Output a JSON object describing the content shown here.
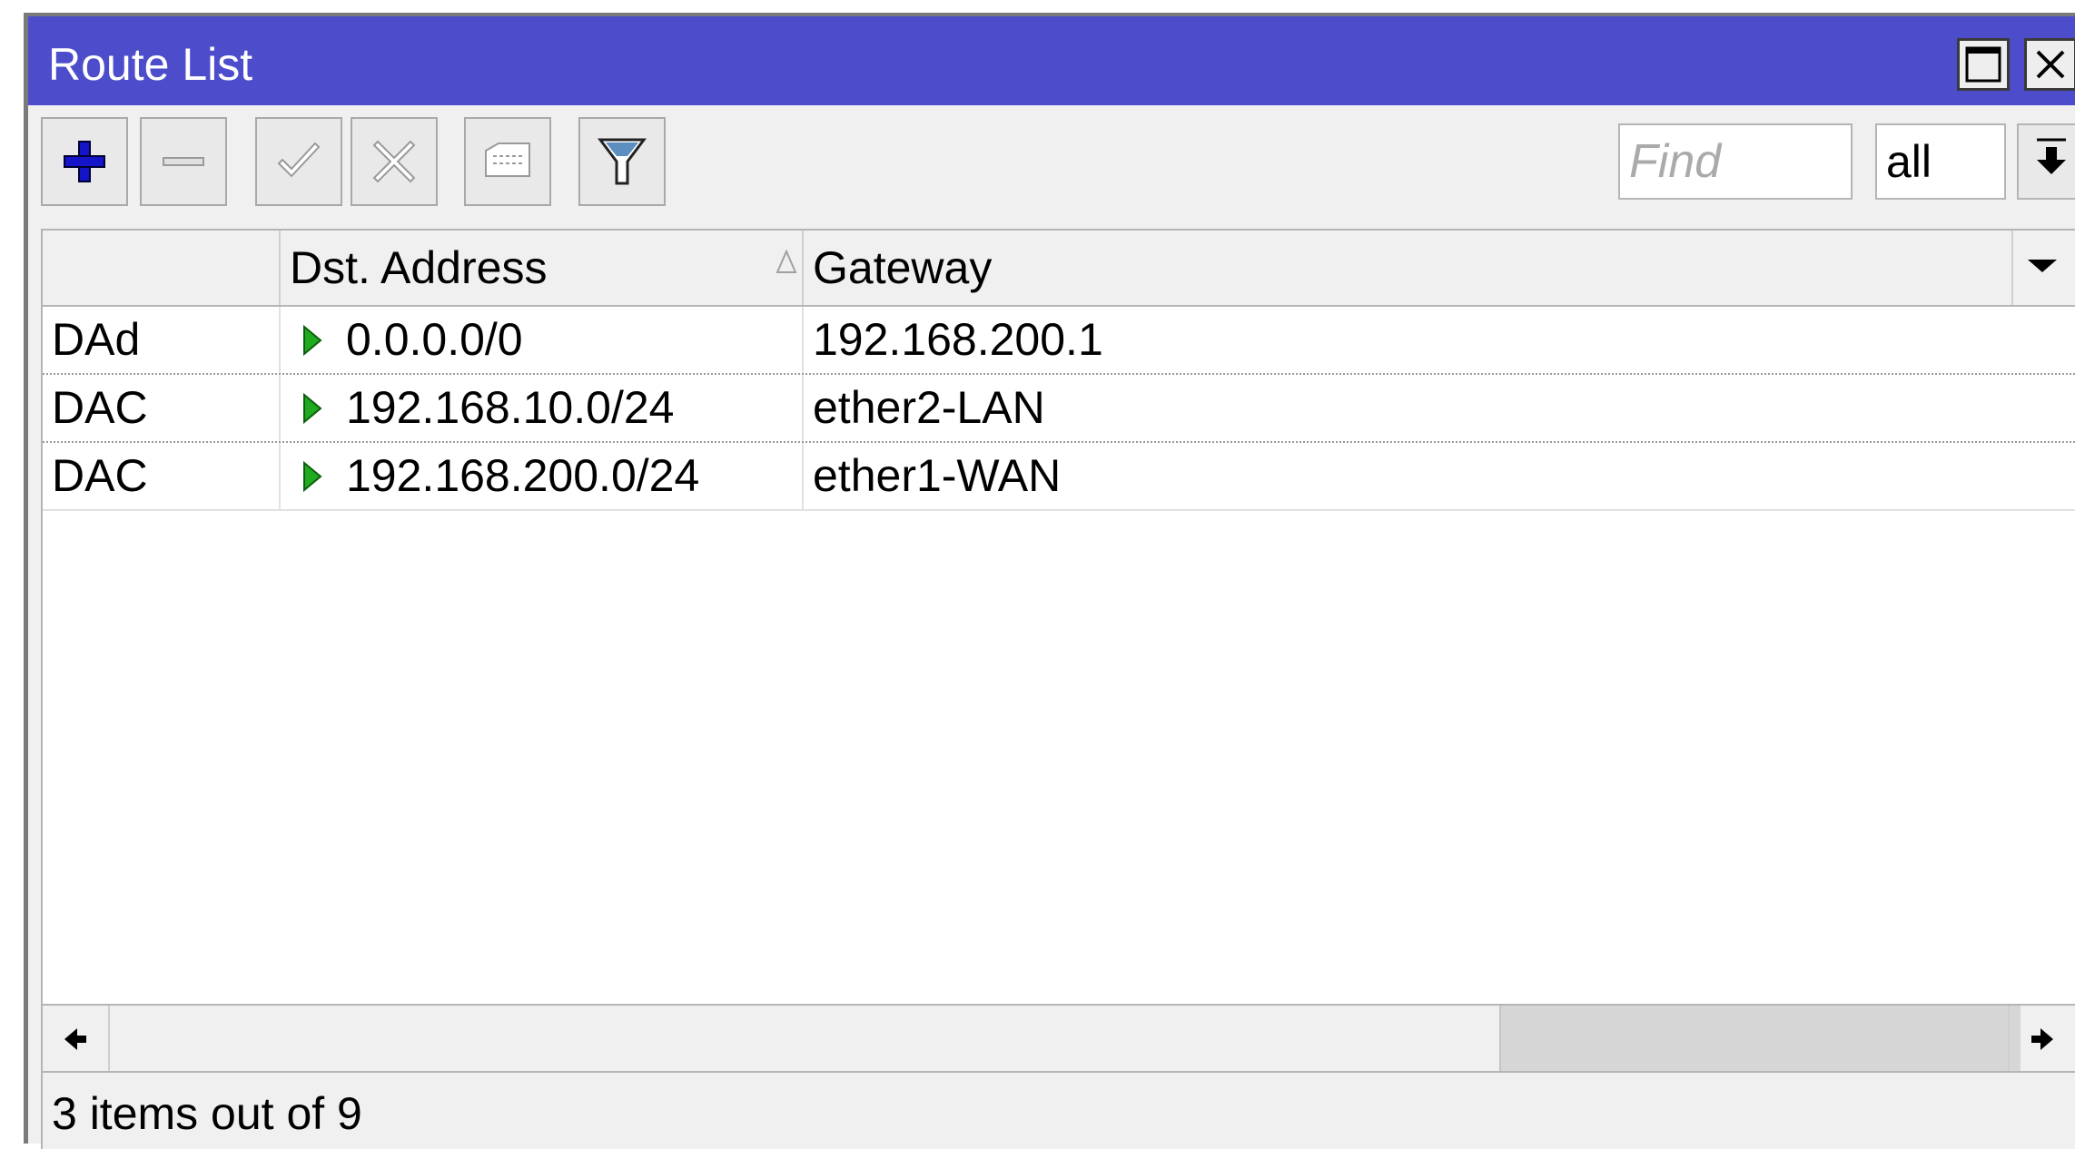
{
  "window": {
    "title": "Route List"
  },
  "toolbar": {
    "buttons": [
      {
        "name": "add",
        "icon": "plus-icon"
      },
      {
        "name": "remove",
        "icon": "minus-icon"
      },
      {
        "name": "enable",
        "icon": "check-icon"
      },
      {
        "name": "disable",
        "icon": "x-icon"
      },
      {
        "name": "comment",
        "icon": "comment-icon"
      },
      {
        "name": "filter",
        "icon": "filter-icon"
      }
    ],
    "find_placeholder": "Find",
    "filter_select_value": "all"
  },
  "table": {
    "columns": [
      "",
      "Dst. Address",
      "Gateway"
    ],
    "sorted_column": "Dst. Address",
    "rows": [
      {
        "flags": "DAd",
        "dst_address": "0.0.0.0/0",
        "gateway": "192.168.200.1"
      },
      {
        "flags": "DAC",
        "dst_address": "192.168.10.0/24",
        "gateway": "ether2-LAN"
      },
      {
        "flags": "DAC",
        "dst_address": "192.168.200.0/24",
        "gateway": "ether1-WAN"
      }
    ]
  },
  "status": {
    "text": "3 items out of 9"
  },
  "colors": {
    "titlebar": "#4d4dcb",
    "add_icon": "#1414c8",
    "active_route_icon": "#1faa1f"
  }
}
